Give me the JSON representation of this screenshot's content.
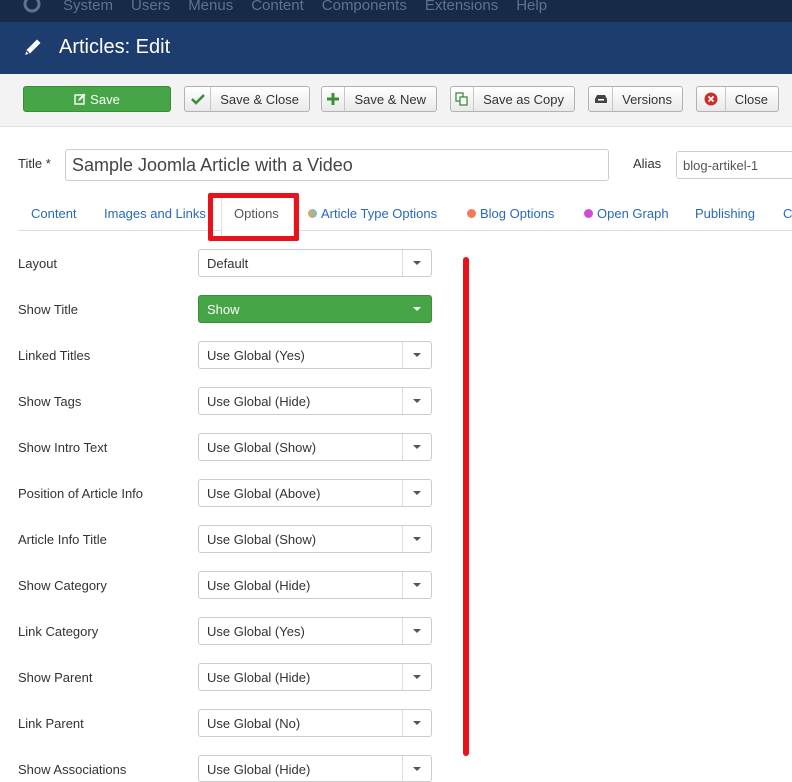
{
  "topmenu": [
    "System",
    "Users",
    "Menus",
    "Content",
    "Components",
    "Extensions",
    "Help"
  ],
  "header": {
    "title": "Articles: Edit"
  },
  "toolbar": {
    "save": "Save",
    "save_close": "Save & Close",
    "save_new": "Save & New",
    "save_copy": "Save as Copy",
    "versions": "Versions",
    "close": "Close"
  },
  "form": {
    "title_label": "Title *",
    "title_value": "Sample Joomla Article with a Video",
    "alias_label": "Alias",
    "alias_value": "blog-artikel-1"
  },
  "tabs": [
    {
      "label": "Content"
    },
    {
      "label": "Images and Links"
    },
    {
      "label": "Options",
      "active": true
    },
    {
      "label": "Article Type Options",
      "dot": "#8bc34a"
    },
    {
      "label": "Blog Options",
      "dot": "#f07c5a"
    },
    {
      "label": "Open Graph",
      "dot": "#d24bd6"
    },
    {
      "label": "Publishing"
    },
    {
      "label": "C"
    }
  ],
  "options": [
    {
      "label": "Layout",
      "value": "Default"
    },
    {
      "label": "Show Title",
      "value": "Show",
      "style": "green"
    },
    {
      "label": "Linked Titles",
      "value": "Use Global (Yes)"
    },
    {
      "label": "Show Tags",
      "value": "Use Global (Hide)"
    },
    {
      "label": "Show Intro Text",
      "value": "Use Global (Show)"
    },
    {
      "label": "Position of Article Info",
      "value": "Use Global (Above)"
    },
    {
      "label": "Article Info Title",
      "value": "Use Global (Show)"
    },
    {
      "label": "Show Category",
      "value": "Use Global (Hide)"
    },
    {
      "label": "Link Category",
      "value": "Use Global (Yes)"
    },
    {
      "label": "Show Parent",
      "value": "Use Global (Hide)"
    },
    {
      "label": "Link Parent",
      "value": "Use Global (No)"
    },
    {
      "label": "Show Associations",
      "value": "Use Global (Hide)"
    }
  ],
  "colors": {
    "accent_green": "#46a546",
    "header_blue": "#1c3d6e",
    "annotation_red": "#e8121b"
  }
}
